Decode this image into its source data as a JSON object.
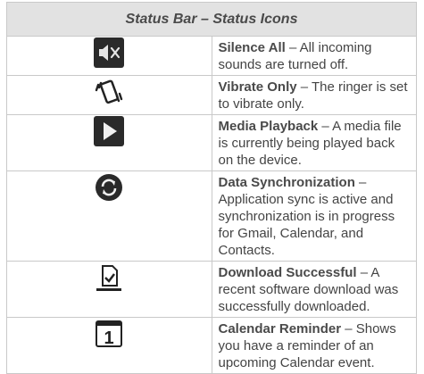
{
  "header": "Status Bar – Status Icons",
  "rows": [
    {
      "icon": "silence-all-icon",
      "title": "Silence All",
      "desc": " – All incoming sounds are turned off."
    },
    {
      "icon": "vibrate-only-icon",
      "title": "Vibrate Only",
      "desc": " – The ringer is set to vibrate only."
    },
    {
      "icon": "media-playback-icon",
      "title": "Media Playback",
      "desc": " – A media file is currently being played back on the device."
    },
    {
      "icon": "data-sync-icon",
      "title": "Data Synchronization",
      "desc": " – Application sync is active and synchronization is in progress for Gmail, Calendar, and Contacts."
    },
    {
      "icon": "download-successful-icon",
      "title": "Download Successful",
      "desc": " – A recent software download was successfully downloaded."
    },
    {
      "icon": "calendar-reminder-icon",
      "title": "Calendar Reminder",
      "desc": " – Shows you have a reminder of an upcoming Calendar event.",
      "badge": "1"
    }
  ]
}
